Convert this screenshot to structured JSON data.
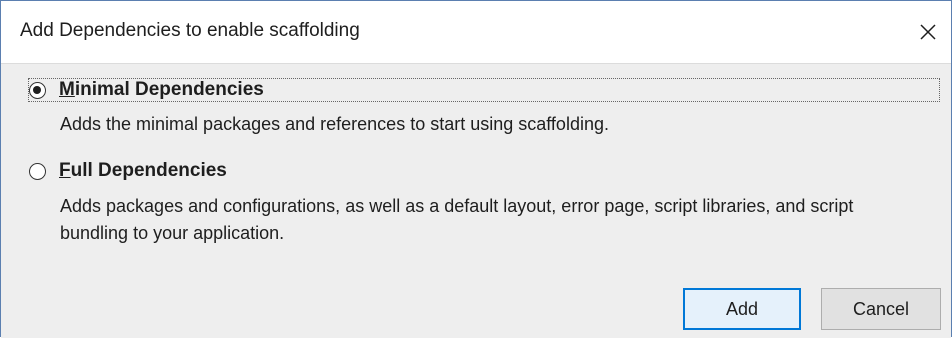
{
  "dialog": {
    "title": "Add Dependencies to enable scaffolding",
    "close_icon": "close-icon"
  },
  "options": [
    {
      "label": "Minimal Dependencies",
      "underlined_letter": "M",
      "rest": "inimal Dependencies",
      "selected": true,
      "description": "Adds the minimal packages and references to start using scaffolding."
    },
    {
      "label": "Full Dependencies",
      "underlined_letter": "F",
      "rest": "ull Dependencies",
      "selected": false,
      "description": "Adds packages and configurations, as well as a default layout, error page, script libraries, and script bundling to your application."
    }
  ],
  "buttons": {
    "add_label": "Add",
    "cancel_label": "Cancel"
  },
  "colors": {
    "border": "#5b7fb0",
    "body_bg": "#eeeeee",
    "default_button_border": "#0078d7",
    "default_button_bg": "#e5f1fb",
    "button_bg": "#e1e1e1"
  }
}
